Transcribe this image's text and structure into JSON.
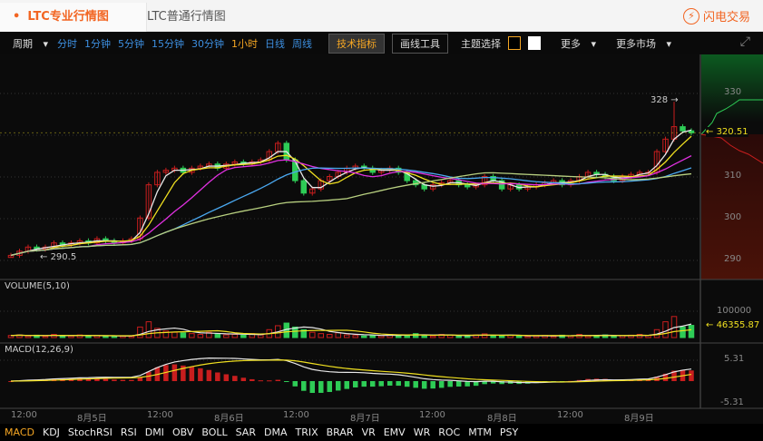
{
  "tabs": {
    "pro": "LTC专业行情图",
    "normal": "LTC普通行情图",
    "flash": "闪电交易"
  },
  "toolbar": {
    "period": "周期",
    "intervals": [
      "分时",
      "1分钟",
      "5分钟",
      "15分钟",
      "30分钟",
      "1小时",
      "日线",
      "周线"
    ],
    "active_interval": "1小时",
    "tech": "技术指标",
    "draw": "画线工具",
    "theme": "主题选择",
    "more": "更多",
    "more_market": "更多市场"
  },
  "price_axis": [
    "330",
    "320",
    "310",
    "300",
    "290"
  ],
  "last_price": "320.51",
  "high_label": "328",
  "low_label": "290.5",
  "volume": {
    "title": "VOLUME(5,10)",
    "axis": "100000",
    "last": "46355.87"
  },
  "macd": {
    "title": "MACD(12,26,9)",
    "axis_top": "5.31",
    "axis_bottom": "-5.31"
  },
  "x_labels": [
    "12:00",
    "8月5日",
    "12:00",
    "8月6日",
    "12:00",
    "8月7日",
    "12:00",
    "8月8日",
    "12:00",
    "8月9日"
  ],
  "indicators": [
    "MACD",
    "KDJ",
    "StochRSI",
    "RSI",
    "DMI",
    "OBV",
    "BOLL",
    "SAR",
    "DMA",
    "TRIX",
    "BRAR",
    "VR",
    "EMV",
    "WR",
    "ROC",
    "MTM",
    "PSY"
  ],
  "active_indicator": "MACD",
  "colors": {
    "up": "#c81e1e",
    "down": "#2ecc56",
    "ma": [
      "#e8e8e8",
      "#f0e020",
      "#e030e0",
      "#4aa8f0",
      "#b8d080"
    ]
  },
  "chart_data": {
    "type": "candlestick",
    "closes": [
      291,
      292,
      293,
      292.5,
      293,
      294,
      293.5,
      294,
      294.5,
      294,
      295,
      294.5,
      294,
      294.5,
      295,
      300,
      308,
      311,
      311.5,
      312,
      311,
      312,
      312.5,
      313,
      312,
      313,
      313.5,
      313,
      313.5,
      314,
      316,
      318,
      314,
      309,
      306,
      307,
      309,
      310,
      311,
      312,
      312.5,
      312,
      311,
      311.5,
      312,
      311,
      309,
      308,
      307,
      308,
      308.5,
      309,
      308,
      307.5,
      308,
      310,
      309,
      307,
      308,
      307,
      307.5,
      308,
      308.5,
      309,
      308,
      309,
      310,
      311,
      310.5,
      310,
      309,
      310,
      310.5,
      311,
      311,
      316,
      319,
      322,
      321,
      320.51
    ],
    "volumes_k": [
      8,
      10,
      6,
      9,
      5,
      12,
      7,
      6,
      10,
      5,
      8,
      6,
      4,
      7,
      5,
      40,
      60,
      35,
      25,
      20,
      18,
      15,
      12,
      20,
      14,
      10,
      12,
      9,
      15,
      10,
      30,
      45,
      55,
      40,
      30,
      20,
      15,
      12,
      18,
      10,
      8,
      6,
      9,
      7,
      12,
      8,
      10,
      15,
      8,
      6,
      12,
      9,
      5,
      7,
      10,
      14,
      8,
      6,
      9,
      7,
      5,
      6,
      8,
      5,
      9,
      7,
      12,
      6,
      8,
      10,
      5,
      7,
      9,
      12,
      8,
      30,
      60,
      80,
      40,
      46.36
    ],
    "ylim": [
      287,
      334
    ]
  }
}
